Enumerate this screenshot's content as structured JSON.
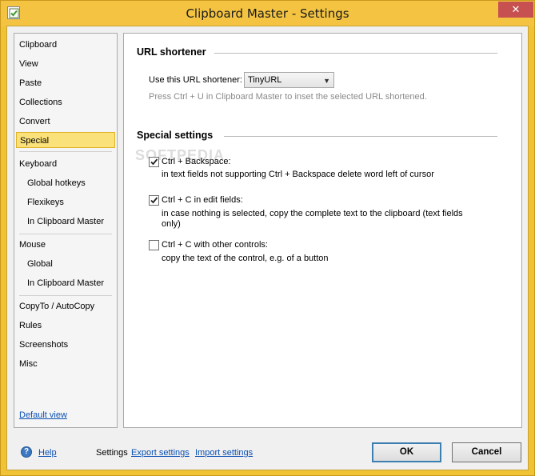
{
  "window": {
    "title": "Clipboard Master - Settings",
    "close_label": "✕"
  },
  "nav": {
    "items": [
      {
        "label": "Clipboard"
      },
      {
        "label": "View"
      },
      {
        "label": "Paste"
      },
      {
        "label": "Collections"
      },
      {
        "label": "Convert"
      },
      {
        "label": "Special"
      },
      {
        "label": "Keyboard"
      },
      {
        "label": "Global hotkeys"
      },
      {
        "label": "Flexikeys"
      },
      {
        "label": "In Clipboard Master"
      },
      {
        "label": "Mouse"
      },
      {
        "label": "Global"
      },
      {
        "label": "In Clipboard Master"
      },
      {
        "label": "CopyTo / AutoCopy"
      },
      {
        "label": "Rules"
      },
      {
        "label": "Screenshots"
      },
      {
        "label": "Misc"
      }
    ],
    "selected": "Special",
    "default_view_link": "Default view"
  },
  "url_section": {
    "title": "URL shortener",
    "use_label": "Use this URL shortener:",
    "select_value": "TinyURL",
    "hint": "Press Ctrl + U in Clipboard Master to inset the selected URL shortened."
  },
  "special_section": {
    "title": "Special settings",
    "options": [
      {
        "label": "Ctrl + Backspace:",
        "description": "in text fields not supporting Ctrl + Backspace delete word left of cursor",
        "checked": true
      },
      {
        "label": "Ctrl + C in edit fields:",
        "description_line1": "in case nothing is selected, copy the complete text to the clipboard (text fields",
        "description_line2": "only)",
        "checked": true
      },
      {
        "label": "Ctrl + C with other controls:",
        "description": "copy the text of the control,  e.g. of a button",
        "checked": false
      }
    ]
  },
  "watermark": "SOFTPEDIA",
  "footer": {
    "help_label": "Help",
    "settings_label": "Settings",
    "export_label": "Export settings",
    "import_label": "Import settings",
    "ok_label": "OK",
    "cancel_label": "Cancel"
  },
  "colors": {
    "accent": "#f3c341",
    "selection": "#fbe17a",
    "link": "#0b50b3"
  }
}
